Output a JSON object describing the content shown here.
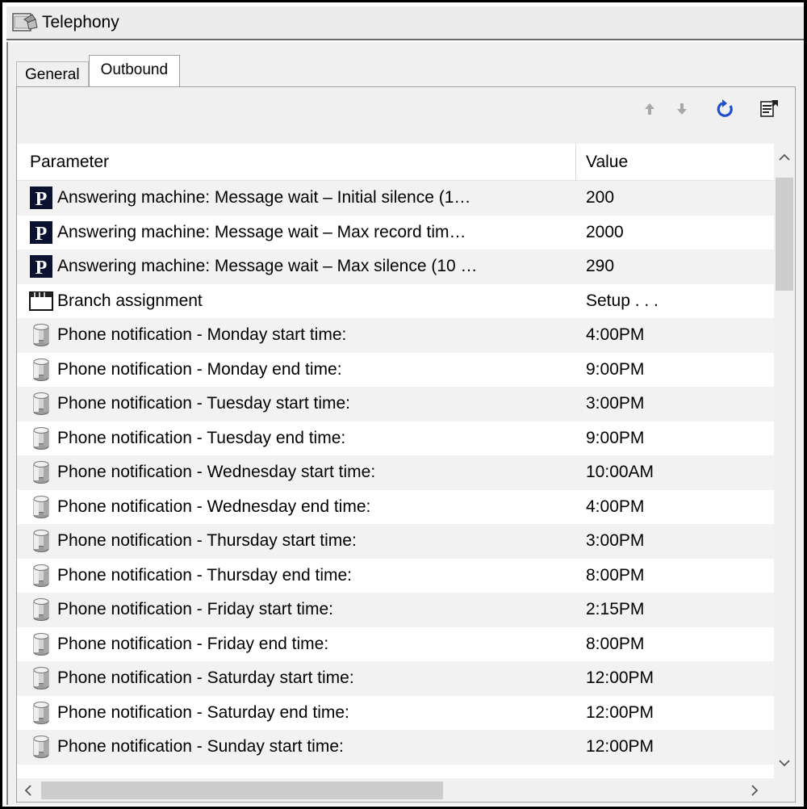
{
  "window": {
    "title": "Telephony",
    "icon": "telephony-folder-icon"
  },
  "tabs": [
    {
      "label": "General",
      "active": false
    },
    {
      "label": "Outbound",
      "active": true
    }
  ],
  "toolbar": {
    "icons": [
      "move-up-arrow-icon",
      "move-down-arrow-icon",
      "refresh-icon",
      "properties-icon"
    ]
  },
  "grid": {
    "columns": {
      "parameter": "Parameter",
      "value": "Value"
    },
    "rows": [
      {
        "icon": "p-parameter-icon",
        "parameter": "Answering machine: Message wait – Initial silence (1…",
        "value": "200"
      },
      {
        "icon": "p-parameter-icon",
        "parameter": "Answering machine: Message wait – Max record tim…",
        "value": "2000"
      },
      {
        "icon": "p-parameter-icon",
        "parameter": "Answering machine: Message wait – Max silence (10 …",
        "value": "290"
      },
      {
        "icon": "window-setup-icon",
        "parameter": "Branch assignment",
        "value": "Setup . . ."
      },
      {
        "icon": "cylinder-icon",
        "parameter": "Phone notification - Monday start time:",
        "value": "4:00PM"
      },
      {
        "icon": "cylinder-icon",
        "parameter": "Phone notification - Monday end time:",
        "value": "9:00PM"
      },
      {
        "icon": "cylinder-icon",
        "parameter": "Phone notification - Tuesday start time:",
        "value": "3:00PM"
      },
      {
        "icon": "cylinder-icon",
        "parameter": "Phone notification - Tuesday end time:",
        "value": "9:00PM"
      },
      {
        "icon": "cylinder-icon",
        "parameter": "Phone notification - Wednesday start time:",
        "value": "10:00AM"
      },
      {
        "icon": "cylinder-icon",
        "parameter": "Phone notification - Wednesday end time:",
        "value": "4:00PM"
      },
      {
        "icon": "cylinder-icon",
        "parameter": "Phone notification - Thursday start time:",
        "value": "3:00PM"
      },
      {
        "icon": "cylinder-icon",
        "parameter": "Phone notification - Thursday end time:",
        "value": "8:00PM"
      },
      {
        "icon": "cylinder-icon",
        "parameter": "Phone notification - Friday start time:",
        "value": "2:15PM"
      },
      {
        "icon": "cylinder-icon",
        "parameter": "Phone notification - Friday end time:",
        "value": "8:00PM"
      },
      {
        "icon": "cylinder-icon",
        "parameter": "Phone notification - Saturday start time:",
        "value": "12:00PM"
      },
      {
        "icon": "cylinder-icon",
        "parameter": "Phone notification - Saturday end time:",
        "value": "12:00PM"
      },
      {
        "icon": "cylinder-icon",
        "parameter": "Phone notification - Sunday start time:",
        "value": "12:00PM"
      }
    ]
  },
  "colors": {
    "p_icon_bg": "#0a1230",
    "refresh_blue": "#1f4fc8",
    "selected_tab": "#ffffff"
  }
}
